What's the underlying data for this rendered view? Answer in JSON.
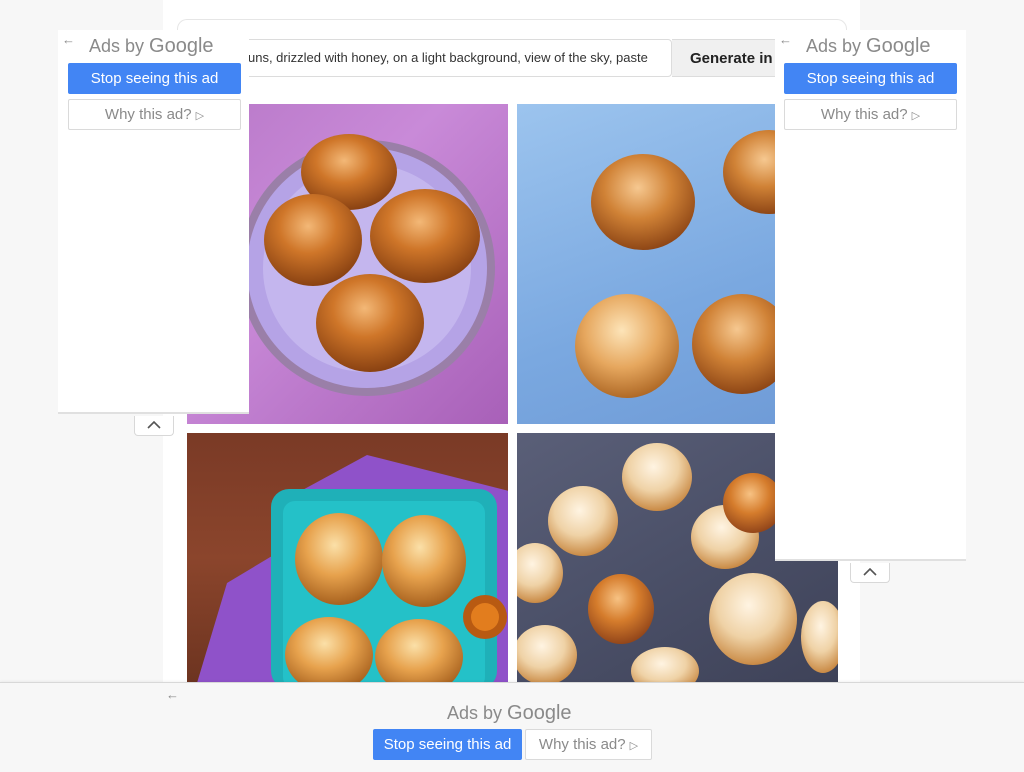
{
  "prompt": {
    "value": "uns, drizzled with honey, on a light background, view of the sky, paste",
    "generate_label": "Generate in"
  },
  "images": [
    {
      "alt": "Honey buns on a purple plate"
    },
    {
      "alt": "Buns on a blue background"
    },
    {
      "alt": "Buns on a teal tray with honey jar"
    },
    {
      "alt": "Knotted rolls on dark stone"
    }
  ],
  "ads": {
    "left": {
      "ads_by": "Ads by",
      "brand": "Google",
      "stop": "Stop seeing this ad",
      "why": "Why this ad?"
    },
    "right": {
      "ads_by": "Ads by",
      "brand": "Google",
      "stop": "Stop seeing this ad",
      "why": "Why this ad?"
    },
    "bottom": {
      "ads_by": "Ads by",
      "brand": "Google",
      "stop": "Stop seeing this ad",
      "why": "Why this ad?"
    }
  },
  "icons": {
    "back": "←",
    "play": "▷"
  },
  "colors": {
    "ad_button": "#4285f4",
    "ad_text": "#8a8a8a"
  }
}
